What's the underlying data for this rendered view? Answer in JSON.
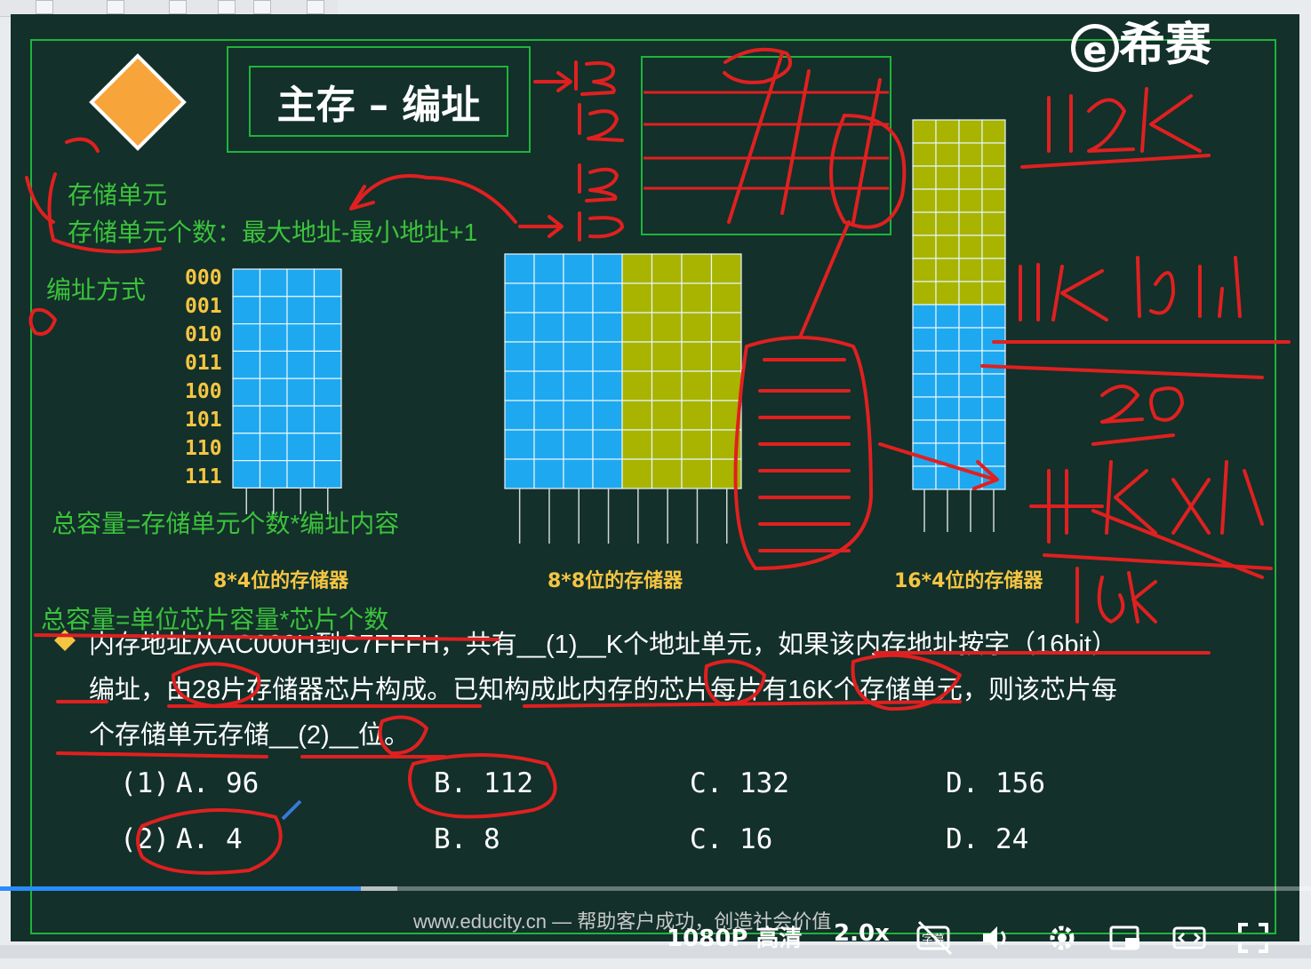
{
  "logo": {
    "mark": "e",
    "name": "希赛"
  },
  "slide": {
    "title": "主存 – 编址",
    "labels": {
      "unit": "存储单元",
      "unit_count": "存储单元个数：最大地址-最小地址+1",
      "addressing": "编址方式",
      "total_capacity": "总容量=存储单元个数*编址内容",
      "total_capacity_chip": "总容量=单位芯片容量*芯片个数"
    },
    "addresses": [
      "000",
      "001",
      "010",
      "011",
      "100",
      "101",
      "110",
      "111"
    ],
    "memory_captions": [
      "8*4位的存储器",
      "8*8位的存储器",
      "16*4位的存储器"
    ],
    "question": {
      "line1": "内存地址从AC000H到C7FFFH，共有__(1)__K个地址单元，如果该内存地址按字（16bit）",
      "line2": "编址，由28片存储器芯片构成。已知构成此内存的芯片每片有16K个存储单元，则该芯片每",
      "line3": "个存储单元存储__(2)__位。"
    },
    "options_1": {
      "prefix": "(1)",
      "a": "A. 96",
      "b": "B. 112",
      "c": "C. 132",
      "d": "D. 156"
    },
    "options_2": {
      "prefix": "(2)",
      "a": "A. 4",
      "b": "B. 8",
      "c": "C. 16",
      "d": "D. 24"
    },
    "footer": "www.educity.cn — 帮助客户成功，创造社会价值"
  },
  "player": {
    "progress": 0.275,
    "buffered": 0.303,
    "quality": "1080P 高清",
    "speed": "2.0x",
    "subtitle_label": "字幕",
    "icons": [
      "subtitle-off-icon",
      "volume-icon",
      "settings-icon",
      "pip-icon",
      "theater-icon",
      "fullscreen-icon"
    ]
  },
  "colors": {
    "board": "#13302a",
    "accent_green": "#1fb43a",
    "cell_blue": "#1ea8f0",
    "cell_olive": "#a8b400",
    "ink_red": "#e02020",
    "diamond": "#f7a43a"
  }
}
